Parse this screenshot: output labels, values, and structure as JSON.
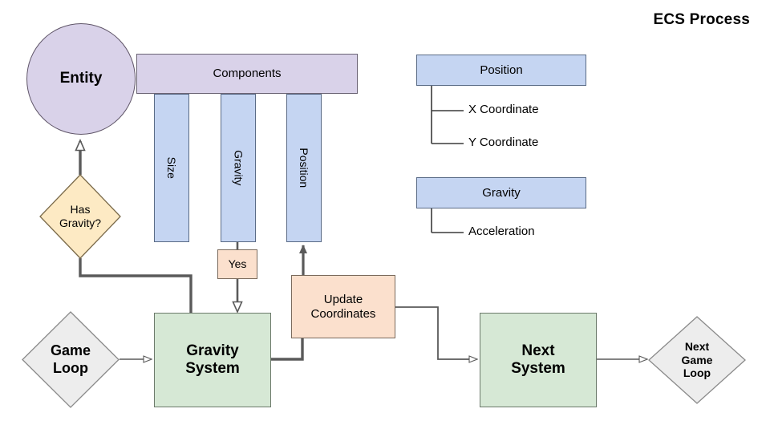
{
  "title": "ECS Process",
  "colors": {
    "entity_fill": "#d9d2e9",
    "components_fill": "#d9d2e9",
    "component_fill": "#c5d5f2",
    "decision_fill": "#fdeac4",
    "terminal_fill": "#ededed",
    "system_fill": "#d6e8d5",
    "process_fill": "#fbe0cd",
    "stroke": "#5a5a5a",
    "background": "#ffffff"
  },
  "entity": {
    "label": "Entity"
  },
  "components": {
    "header_label": "Components",
    "lanes": [
      {
        "label": "Size"
      },
      {
        "label": "Gravity"
      },
      {
        "label": "Position"
      }
    ]
  },
  "decision": {
    "label": "Has\nGravity?",
    "line1": "Has",
    "line2": "Gravity?",
    "yes_label": "Yes"
  },
  "flow": {
    "game_loop": {
      "line1": "Game",
      "line2": "Loop"
    },
    "gravity_system": {
      "line1": "Gravity",
      "line2": "System"
    },
    "update_coordinates": {
      "line1": "Update",
      "line2": "Coordinates"
    },
    "next_system": {
      "line1": "Next",
      "line2": "System"
    },
    "next_game_loop": {
      "line1": "Next",
      "line2": "Game",
      "line3": "Loop"
    }
  },
  "reference": {
    "position": {
      "header": "Position",
      "fields": [
        "X Coordinate",
        "Y Coordinate"
      ]
    },
    "gravity": {
      "header": "Gravity",
      "fields": [
        "Acceleration"
      ]
    }
  }
}
